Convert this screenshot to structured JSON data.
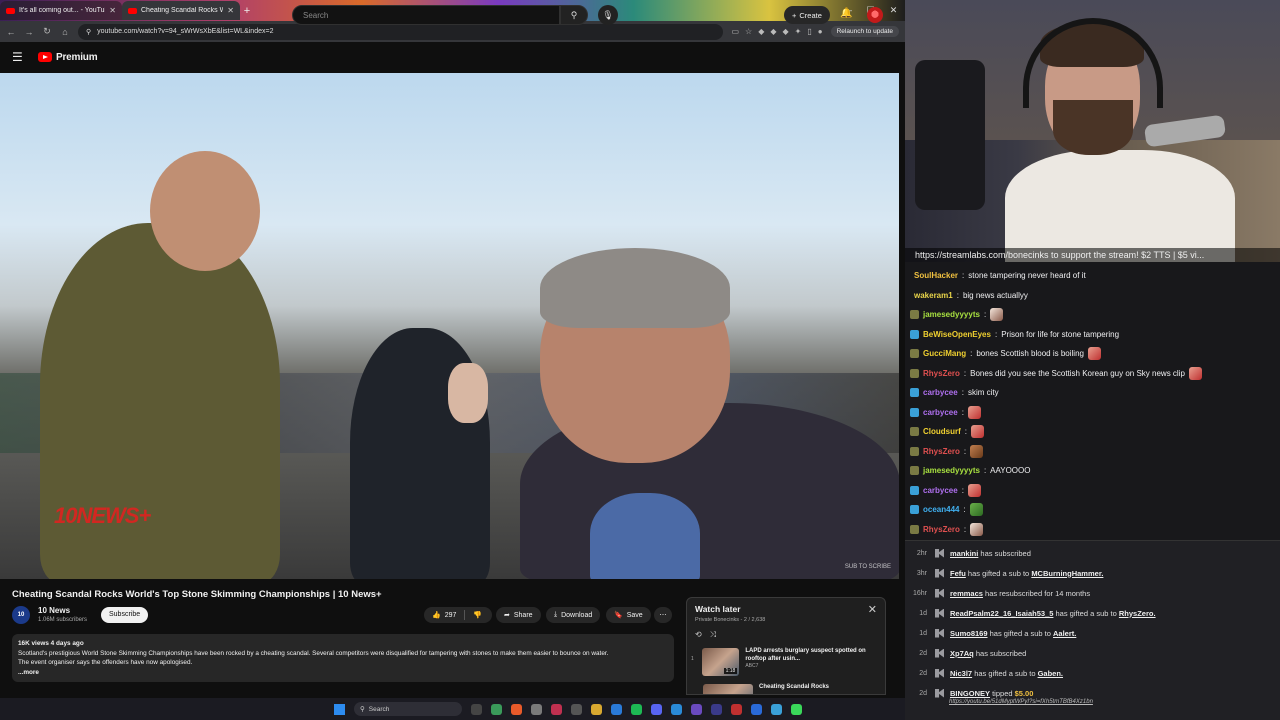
{
  "browser": {
    "tabs": [
      {
        "label": "It's all coming out... - YouTube"
      },
      {
        "label": "Cheating Scandal Rocks W..."
      }
    ],
    "url": "youtube.com/watch?v=94_sWrWsXbE&list=WL&index=2",
    "relaunch_label": "Relaunch to update"
  },
  "youtube": {
    "logo_text": "Premium",
    "search_placeholder": "Search",
    "create_label": "Create",
    "video": {
      "title": "Cheating Scandal Rocks World's Top Stone Skimming Championships | 10 News+",
      "watermark": "10NEWS+",
      "corner_mark": "SUB TO SCRIBE"
    },
    "channel": {
      "avatar_text": "10",
      "name": "10 News",
      "subs": "1.06M subscribers",
      "subscribe_label": "Subscribe"
    },
    "actions": {
      "likes": "297",
      "share": "Share",
      "download": "Download",
      "save": "Save"
    },
    "description": {
      "meta": "16K views  4 days ago",
      "line1": "Scotland's prestigious World Stone Skimming Championships have been rocked by a cheating scandal. Several competitors were disqualified for tampering with stones to make them easier to bounce on water.",
      "line2": "The event organiser says the offenders have now apologised.",
      "more": "...more"
    },
    "watch_later": {
      "title": "Watch later",
      "sub": "Private  Bonecinks - 2 / 2,638",
      "items": [
        {
          "num": "1",
          "title": "LAPD arrests burglary suspect spotted on rooftop after usin...",
          "channel": "ABC7",
          "duration": "1:18"
        },
        {
          "num": "",
          "title": "Cheating Scandal Rocks",
          "channel": "",
          "duration": ""
        }
      ]
    }
  },
  "taskbar": {
    "search_label": "Search"
  },
  "stream": {
    "ticker": "https://streamlabs.com/bonecinks to support the stream! $2 TTS | $5 vi..."
  },
  "chat": [
    {
      "user": "SoulHacker",
      "color": "#f0c040",
      "badge": "x",
      "text": "stone tampering never heard of it",
      "emote": ""
    },
    {
      "user": "wakeram1",
      "color": "#e8d44a",
      "badge": "x",
      "text": "big news actuallyy",
      "emote": ""
    },
    {
      "user": "jamesedyyyyts",
      "color": "#a8e040",
      "badge": "sub",
      "text": "",
      "emote": "face"
    },
    {
      "user": "BeWiseOpenEyes",
      "color": "#f0d030",
      "badge": "blue",
      "text": "Prison for life for stone tampering",
      "emote": ""
    },
    {
      "user": "GucciMang",
      "color": "#f0d030",
      "badge": "sub",
      "text": "bones Scottish blood is boiling",
      "emote": "red"
    },
    {
      "user": "RhysZero",
      "color": "#e05050",
      "badge": "sub",
      "text": "Bones did you see the Scottish Korean guy on Sky news clip",
      "emote": "red"
    },
    {
      "user": "carbycee",
      "color": "#b070f0",
      "badge": "blue",
      "text": "skim city",
      "emote": ""
    },
    {
      "user": "carbycee",
      "color": "#b070f0",
      "badge": "blue",
      "text": "",
      "emote": "red"
    },
    {
      "user": "Cloudsurf",
      "color": "#f0d030",
      "badge": "sub",
      "text": "",
      "emote": "red"
    },
    {
      "user": "RhysZero",
      "color": "#e05050",
      "badge": "sub",
      "text": "",
      "emote": "brown"
    },
    {
      "user": "jamesedyyyyts",
      "color": "#a8e040",
      "badge": "sub",
      "text": "AAYOOOO",
      "emote": ""
    },
    {
      "user": "carbycee",
      "color": "#b070f0",
      "badge": "blue",
      "text": "",
      "emote": "red"
    },
    {
      "user": "ocean444",
      "color": "#40b0f0",
      "badge": "blue",
      "text": "",
      "emote": "green"
    },
    {
      "user": "RhysZero",
      "color": "#e05050",
      "badge": "sub",
      "text": "",
      "emote": "face"
    }
  ],
  "events": [
    {
      "time": "2hr",
      "pre": "",
      "name": "mankini",
      "post": " has subscribed",
      "name2": ""
    },
    {
      "time": "3hr",
      "pre": "",
      "name": "Fefu",
      "post": " has gifted a sub to ",
      "name2": "MCBurningHammer."
    },
    {
      "time": "16hr",
      "pre": "",
      "name": "remmacs",
      "post": " has resubscribed for 14 months",
      "name2": ""
    },
    {
      "time": "1d",
      "pre": "",
      "name": "ReadPsalm22_16_Isaiah53_5",
      "post": " has gifted a sub to ",
      "name2": "RhysZero."
    },
    {
      "time": "1d",
      "pre": "",
      "name": "Sumo8169",
      "post": " has gifted a sub to ",
      "name2": "Aalert."
    },
    {
      "time": "2d",
      "pre": "",
      "name": "Xp7Aq",
      "post": " has subscribed",
      "name2": ""
    },
    {
      "time": "2d",
      "pre": "",
      "name": "Nic3l7",
      "post": " has gifted a sub to ",
      "name2": "Gaben."
    },
    {
      "time": "2d",
      "pre": "",
      "name": "BINGONEY",
      "post": " tipped ",
      "name2": "$5.00"
    }
  ],
  "tip_url": "https://youtu.be/51dMyptWPyI?si=fXh5tmTBfB4Xz1bn",
  "colors": {
    "youtube_red": "#ff0000",
    "chat_bg": "#18181b",
    "tip_amount": "#f0c040"
  }
}
